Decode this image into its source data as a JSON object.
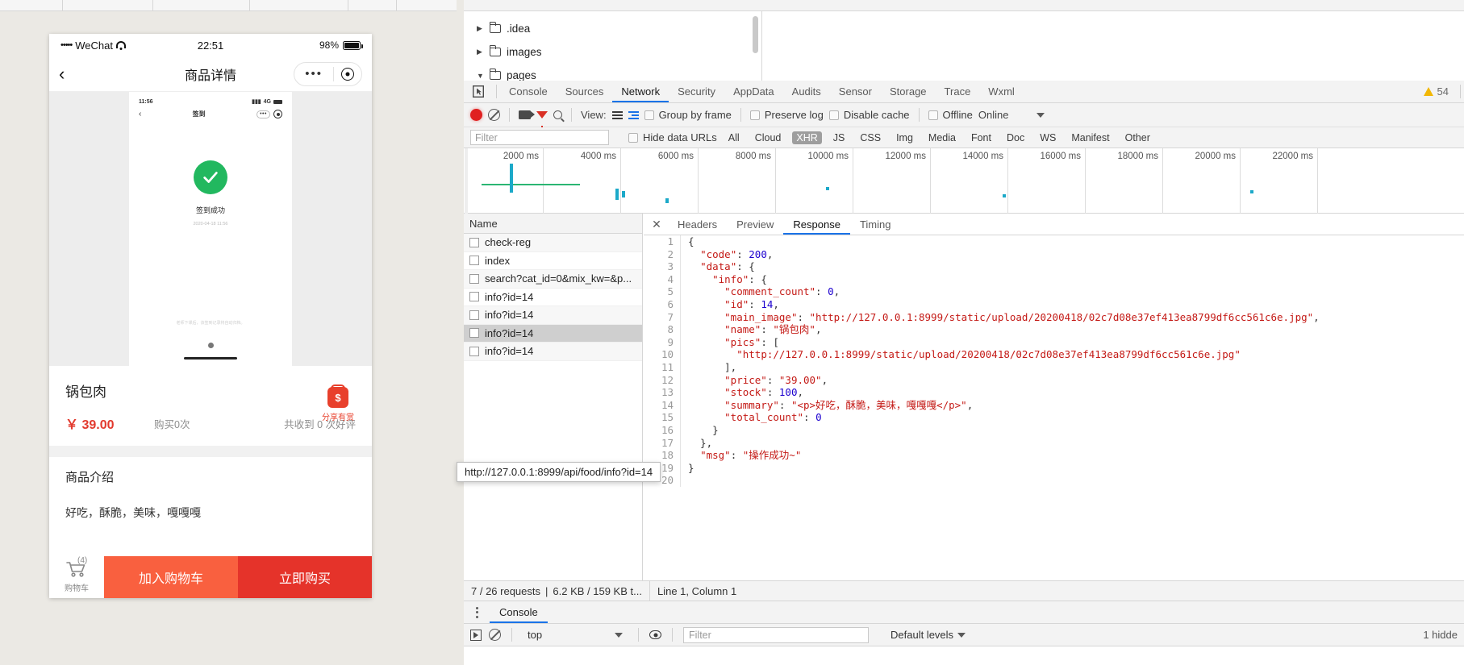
{
  "simulator": {
    "status_bar": {
      "dots": "•••••",
      "carrier": "WeChat",
      "time": "22:51",
      "battery": "98%"
    },
    "nav": {
      "back_icon": "‹",
      "title": "商品详情",
      "menu_dots": "•••"
    },
    "mini_preview": {
      "time": "11:56",
      "network": "4G",
      "title": "签到",
      "back_icon": "‹",
      "success_text": "签到成功",
      "date_text": "2020-04-18 11:56",
      "note": "老师下课后，该签到记录将自动归档。"
    },
    "product": {
      "name": "锅包肉",
      "price": "￥ 39.00",
      "purchase_count": "购买0次",
      "review_count": "共收到 0 次好评",
      "share_label": "分享有赏",
      "share_symbol": "$"
    },
    "intro": {
      "title": "商品介绍",
      "body": "好吃，酥脆，美味，嘎嘎嘎"
    },
    "actions": {
      "cart_label": "购物车",
      "cart_badge": "(4)",
      "add_to_cart": "加入购物车",
      "buy_now": "立即购买"
    }
  },
  "devtools": {
    "file_tree": [
      {
        "label": ".idea"
      },
      {
        "label": "images"
      },
      {
        "label": "pages"
      }
    ],
    "tabs": [
      {
        "label": "Console",
        "active": false
      },
      {
        "label": "Sources",
        "active": false
      },
      {
        "label": "Network",
        "active": true
      },
      {
        "label": "Security",
        "active": false
      },
      {
        "label": "AppData",
        "active": false
      },
      {
        "label": "Audits",
        "active": false
      },
      {
        "label": "Sensor",
        "active": false
      },
      {
        "label": "Storage",
        "active": false
      },
      {
        "label": "Trace",
        "active": false
      },
      {
        "label": "Wxml",
        "active": false
      }
    ],
    "warning_count": "54",
    "toolbar": {
      "view_label": "View:",
      "group_by_frame": "Group by frame",
      "preserve_log": "Preserve log",
      "disable_cache": "Disable cache",
      "offline": "Offline",
      "online": "Online"
    },
    "filter_bar": {
      "filter_placeholder": "Filter",
      "hide_data_urls": "Hide data URLs",
      "types": [
        "All",
        "Cloud",
        "XHR",
        "JS",
        "CSS",
        "Img",
        "Media",
        "Font",
        "Doc",
        "WS",
        "Manifest",
        "Other"
      ],
      "active_type": "XHR"
    },
    "timeline_ticks": [
      "2000 ms",
      "4000 ms",
      "6000 ms",
      "8000 ms",
      "10000 ms",
      "12000 ms",
      "14000 ms",
      "16000 ms",
      "18000 ms",
      "20000 ms",
      "22000 ms"
    ],
    "requests": {
      "column_header": "Name",
      "rows": [
        {
          "name": "check-reg",
          "selected": false
        },
        {
          "name": "index",
          "selected": false
        },
        {
          "name": "search?cat_id=0&mix_kw=&p...",
          "selected": false
        },
        {
          "name": "info?id=14",
          "selected": false
        },
        {
          "name": "info?id=14",
          "selected": false
        },
        {
          "name": "info?id=14",
          "selected": true
        },
        {
          "name": "info?id=14",
          "selected": false
        }
      ]
    },
    "tooltip": "http://127.0.0.1:8999/api/food/info?id=14",
    "detail_tabs": [
      {
        "label": "Headers",
        "active": false
      },
      {
        "label": "Preview",
        "active": false
      },
      {
        "label": "Response",
        "active": true
      },
      {
        "label": "Timing",
        "active": false
      }
    ],
    "response_lines": [
      {
        "no": "1",
        "text": "{"
      },
      {
        "no": "2",
        "text": "  \"code\": 200,"
      },
      {
        "no": "3",
        "text": "  \"data\": {"
      },
      {
        "no": "4",
        "text": "    \"info\": {"
      },
      {
        "no": "5",
        "text": "      \"comment_count\": 0,"
      },
      {
        "no": "6",
        "text": "      \"id\": 14,"
      },
      {
        "no": "7",
        "text": "      \"main_image\": \"http://127.0.0.1:8999/static/upload/20200418/02c7d08e37ef413ea8799df6cc561c6e.jpg\","
      },
      {
        "no": "8",
        "text": "      \"name\": \"锅包肉\","
      },
      {
        "no": "9",
        "text": "      \"pics\": ["
      },
      {
        "no": "10",
        "text": "        \"http://127.0.0.1:8999/static/upload/20200418/02c7d08e37ef413ea8799df6cc561c6e.jpg\""
      },
      {
        "no": "11",
        "text": "      ],"
      },
      {
        "no": "12",
        "text": "      \"price\": \"39.00\","
      },
      {
        "no": "13",
        "text": "      \"stock\": 100,"
      },
      {
        "no": "14",
        "text": "      \"summary\": \"<p>好吃，酥脆，美味，嘎嘎嘎</p>\","
      },
      {
        "no": "15",
        "text": "      \"total_count\": 0"
      },
      {
        "no": "16",
        "text": "    }"
      },
      {
        "no": "17",
        "text": "  },"
      },
      {
        "no": "18",
        "text": "  \"msg\": \"操作成功~\""
      },
      {
        "no": "19",
        "text": "}"
      },
      {
        "no": "20",
        "text": ""
      }
    ],
    "status_bar": {
      "requests": "7 / 26 requests",
      "separator": "|",
      "transferred": "6.2 KB / 159 KB t...",
      "cursor": "Line 1, Column 1"
    },
    "drawer": {
      "tab": "Console",
      "context": "top",
      "filter_placeholder": "Filter",
      "levels": "Default levels",
      "hidden": "1 hidde"
    }
  },
  "colors": {
    "accent_blue": "#1a73e8",
    "record_red": "#e02020",
    "brand_orange": "#f9603f",
    "brand_red": "#e5332a",
    "price_red": "#e23a2e",
    "success_green": "#22b85f"
  }
}
